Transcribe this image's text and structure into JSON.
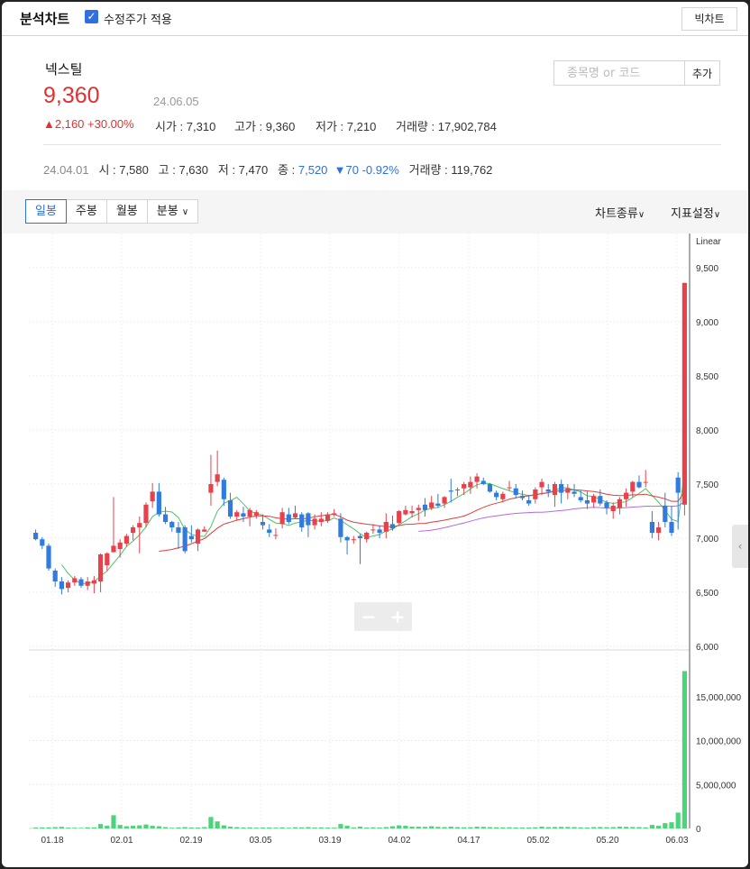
{
  "header": {
    "title": "분석차트",
    "adjusted_label": "수정주가 적용",
    "big_chart_label": "빅차트"
  },
  "stock": {
    "name": "넥스틸",
    "price": "9,360",
    "date": "24.06.05",
    "change": "2,160 +30.00%",
    "open_label": "시가",
    "open": "7,310",
    "high_label": "고가",
    "high": "9,360",
    "low_label": "저가",
    "low": "7,210",
    "volume_label": "거래량",
    "volume": "17,902,784"
  },
  "search": {
    "placeholder": "종목명 or 코드",
    "add_label": "추가"
  },
  "cursor": {
    "date": "24.04.01",
    "open_label": "시",
    "open": "7,580",
    "high_label": "고",
    "high": "7,630",
    "low_label": "저",
    "low": "7,470",
    "close_label": "종",
    "close": "7,520",
    "change": "70 -0.92%",
    "volume_label": "거래량",
    "volume": "119,762"
  },
  "toolbar": {
    "tabs": [
      "일봉",
      "주봉",
      "월봉",
      "분봉"
    ],
    "chart_type": "차트종류",
    "indicator": "지표설정"
  },
  "colors": {
    "up": "#e8414b",
    "down": "#2f7be0",
    "ma5": "#4cc26a",
    "ma20": "#e03c3c",
    "ma60": "#b56ae0",
    "ma120": "#f0a050",
    "volume": "#4cd47a"
  },
  "chart_data": {
    "type": "candlestick",
    "scale": "Linear",
    "price_axis": {
      "ticks": [
        "6,000",
        "6,500",
        "7,000",
        "7,500",
        "8,000",
        "8,500",
        "9,000",
        "9,500"
      ],
      "range": [
        6000,
        9750
      ]
    },
    "volume_axis": {
      "ticks": [
        "0",
        "5,000,000",
        "10,000,000",
        "15,000,000"
      ],
      "range": [
        0,
        20000000
      ]
    },
    "x_ticks": [
      "01.18",
      "02.01",
      "02.19",
      "03.05",
      "03.19",
      "04.02",
      "04.17",
      "05.02",
      "05.20",
      "06.03"
    ],
    "candles": [
      [
        7050,
        7080,
        6980,
        6990,
        100000
      ],
      [
        6990,
        7010,
        6900,
        6930,
        110000
      ],
      [
        6930,
        6950,
        6700,
        6720,
        120000
      ],
      [
        6700,
        6720,
        6550,
        6600,
        150000
      ],
      [
        6600,
        6640,
        6480,
        6530,
        180000
      ],
      [
        6540,
        6610,
        6500,
        6590,
        90000
      ],
      [
        6590,
        6650,
        6560,
        6630,
        80000
      ],
      [
        6620,
        6640,
        6540,
        6560,
        70000
      ],
      [
        6560,
        6640,
        6520,
        6600,
        120000
      ],
      [
        6580,
        6650,
        6490,
        6610,
        110000
      ],
      [
        6600,
        6860,
        6500,
        6850,
        500000
      ],
      [
        6750,
        6870,
        6700,
        6860,
        300000
      ],
      [
        6870,
        7380,
        6870,
        6930,
        1500000
      ],
      [
        6900,
        6990,
        6820,
        6960,
        400000
      ],
      [
        6950,
        7040,
        6920,
        7020,
        250000
      ],
      [
        7050,
        7120,
        6980,
        7100,
        300000
      ],
      [
        7100,
        7200,
        6860,
        7140,
        350000
      ],
      [
        7140,
        7330,
        7100,
        7310,
        450000
      ],
      [
        7340,
        7510,
        7280,
        7430,
        300000
      ],
      [
        7430,
        7510,
        7200,
        7220,
        250000
      ],
      [
        7220,
        7290,
        7130,
        7150,
        150000
      ],
      [
        7150,
        7160,
        7060,
        7100,
        80000
      ],
      [
        7100,
        7150,
        6900,
        7050,
        120000
      ],
      [
        7100,
        7120,
        6860,
        6880,
        150000
      ],
      [
        7020,
        7120,
        6960,
        6990,
        100000
      ],
      [
        6950,
        7090,
        6880,
        7080,
        100000
      ],
      [
        7060,
        7110,
        7060,
        7080,
        150000
      ],
      [
        7420,
        7770,
        7300,
        7500,
        1300000
      ],
      [
        7520,
        7810,
        7480,
        7590,
        800000
      ],
      [
        7540,
        7560,
        7300,
        7360,
        350000
      ],
      [
        7350,
        7420,
        7180,
        7200,
        200000
      ],
      [
        7200,
        7260,
        7160,
        7240,
        150000
      ],
      [
        7230,
        7290,
        7150,
        7200,
        100000
      ],
      [
        7200,
        7280,
        7110,
        7260,
        120000
      ],
      [
        7210,
        7260,
        7180,
        7240,
        90000
      ],
      [
        7150,
        7220,
        7080,
        7120,
        100000
      ],
      [
        7080,
        7130,
        7010,
        7050,
        110000
      ],
      [
        7030,
        7090,
        6990,
        7030,
        90000
      ],
      [
        7130,
        7280,
        7090,
        7240,
        120000
      ],
      [
        7220,
        7280,
        7130,
        7150,
        80000
      ],
      [
        7190,
        7300,
        7180,
        7230,
        130000
      ],
      [
        7220,
        7240,
        7060,
        7100,
        120000
      ],
      [
        7230,
        7240,
        7010,
        7120,
        150000
      ],
      [
        7120,
        7220,
        7080,
        7180,
        100000
      ],
      [
        7150,
        7240,
        7110,
        7180,
        120000
      ],
      [
        7160,
        7240,
        7140,
        7220,
        100000
      ],
      [
        7220,
        7270,
        7200,
        7230,
        90000
      ],
      [
        7180,
        7230,
        6960,
        7010,
        500000
      ],
      [
        7010,
        7020,
        6850,
        6980,
        300000
      ],
      [
        6990,
        7020,
        6950,
        6990,
        100000
      ],
      [
        7020,
        7040,
        6760,
        7000,
        200000
      ],
      [
        6990,
        7060,
        6960,
        7050,
        100000
      ],
      [
        7080,
        7130,
        7040,
        7080,
        120000
      ],
      [
        7080,
        7120,
        7000,
        7050,
        100000
      ],
      [
        7060,
        7230,
        7000,
        7150,
        150000
      ],
      [
        7130,
        7210,
        7070,
        7090,
        250000
      ],
      [
        7140,
        7260,
        7130,
        7250,
        350000
      ],
      [
        7220,
        7300,
        7210,
        7260,
        300000
      ],
      [
        7230,
        7300,
        7190,
        7250,
        200000
      ],
      [
        7260,
        7310,
        7160,
        7280,
        200000
      ],
      [
        7310,
        7370,
        7200,
        7260,
        180000
      ],
      [
        7280,
        7390,
        7260,
        7330,
        250000
      ],
      [
        7320,
        7410,
        7280,
        7300,
        180000
      ],
      [
        7320,
        7390,
        7280,
        7380,
        150000
      ],
      [
        7440,
        7550,
        7330,
        7430,
        200000
      ],
      [
        7450,
        7470,
        7390,
        7450,
        150000
      ],
      [
        7460,
        7520,
        7400,
        7500,
        130000
      ],
      [
        7470,
        7570,
        7410,
        7520,
        140000
      ],
      [
        7520,
        7600,
        7460,
        7570,
        200000
      ],
      [
        7530,
        7560,
        7490,
        7500,
        180000
      ],
      [
        7500,
        7510,
        7420,
        7430,
        150000
      ],
      [
        7420,
        7440,
        7350,
        7380,
        130000
      ],
      [
        7360,
        7430,
        7330,
        7410,
        120000
      ],
      [
        7470,
        7530,
        7440,
        7470,
        130000
      ],
      [
        7460,
        7500,
        7370,
        7400,
        110000
      ],
      [
        7390,
        7440,
        7350,
        7370,
        100000
      ],
      [
        7350,
        7400,
        7300,
        7320,
        110000
      ],
      [
        7360,
        7470,
        7320,
        7450,
        130000
      ],
      [
        7470,
        7550,
        7400,
        7520,
        200000
      ],
      [
        7450,
        7500,
        7380,
        7430,
        150000
      ],
      [
        7400,
        7520,
        7290,
        7500,
        160000
      ],
      [
        7500,
        7540,
        7320,
        7420,
        180000
      ],
      [
        7420,
        7500,
        7360,
        7460,
        170000
      ],
      [
        7430,
        7500,
        7380,
        7410,
        150000
      ],
      [
        7380,
        7440,
        7330,
        7350,
        120000
      ],
      [
        7350,
        7430,
        7270,
        7320,
        110000
      ],
      [
        7330,
        7410,
        7280,
        7390,
        150000
      ],
      [
        7390,
        7450,
        7300,
        7320,
        160000
      ],
      [
        7330,
        7350,
        7220,
        7280,
        140000
      ],
      [
        7250,
        7330,
        7180,
        7300,
        150000
      ],
      [
        7280,
        7380,
        7220,
        7360,
        200000
      ],
      [
        7360,
        7460,
        7290,
        7420,
        180000
      ],
      [
        7430,
        7530,
        7380,
        7520,
        160000
      ],
      [
        7520,
        7580,
        7460,
        7470,
        150000
      ],
      [
        7520,
        7630,
        7470,
        7520,
        120000
      ]
    ],
    "y_label": "Linear"
  }
}
